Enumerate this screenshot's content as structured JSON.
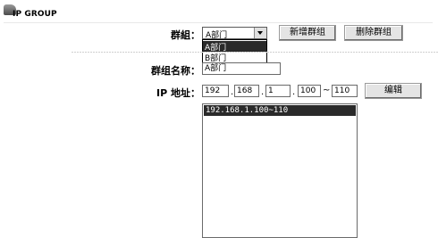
{
  "header": {
    "title": "IP GROUP",
    "icon": "folder-tab-icon"
  },
  "group": {
    "label": "群組：",
    "selected": "A部门",
    "options": [
      "A部门",
      "B部门"
    ]
  },
  "buttons": {
    "add_group": "新增群组",
    "delete_group": "删除群组",
    "edit": "编辑"
  },
  "group_name": {
    "label": "群组名称：",
    "value": "A部门"
  },
  "ip_address": {
    "label": "IP 地址：",
    "octet1": "192",
    "octet2": "168",
    "octet3": "1",
    "octet4": "100",
    "range_end": "110",
    "range_separator": "~",
    "dot": "."
  },
  "ip_list": [
    "192.168.1.100~110"
  ]
}
